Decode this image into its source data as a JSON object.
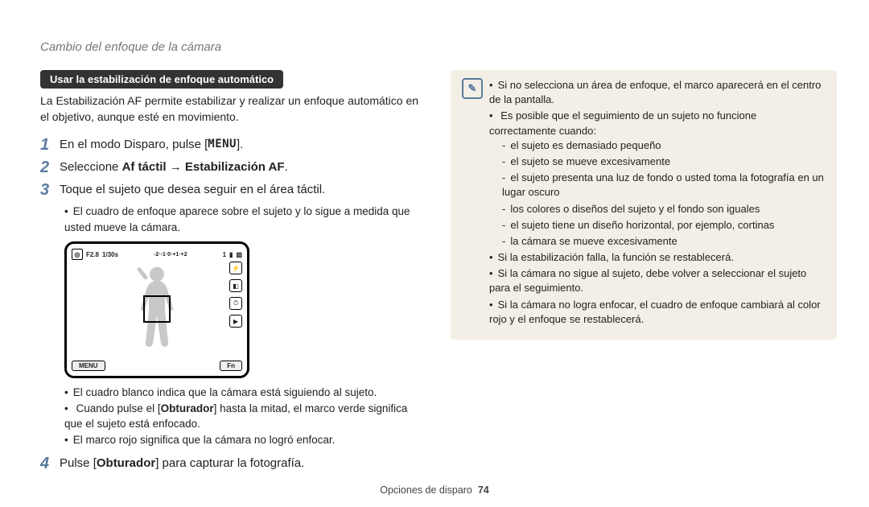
{
  "pageTitle": "Cambio del enfoque de la cámara",
  "section": {
    "pill": "Usar la estabilización de enfoque automático",
    "intro": "La Estabilización AF permite estabilizar y realizar un enfoque automático en el objetivo, aunque esté en movimiento."
  },
  "steps": {
    "s1_pre": "En el modo Disparo, pulse [",
    "s1_key": "MENU",
    "s1_post": "].",
    "s2_pre": "Seleccione ",
    "s2_b1": "Af táctil",
    "s2_arrow": " → ",
    "s2_b2": "Estabilización AF",
    "s2_post": ".",
    "s3": "Toque el sujeto que desea seguir en el área táctil.",
    "s3_sub": "El cuadro de enfoque aparece sobre el sujeto y lo sigue a medida que usted mueve la cámara.",
    "s4_pre": "Pulse [",
    "s4_b": "Obturador",
    "s4_post": "] para capturar la fotografía."
  },
  "cam": {
    "f": "F2.8",
    "shutter": "1/30s",
    "count": "1",
    "menuBtn": "MENU",
    "fnBtn": "Fn"
  },
  "postCamBullets": {
    "b1": "El cuadro blanco indica que la cámara está siguiendo al sujeto.",
    "b2_pre": "Cuando pulse el [",
    "b2_b": "Obturador",
    "b2_post": "] hasta la mitad, el marco verde significa que el sujeto está enfocado.",
    "b3": "El marco rojo significa que la cámara no logró enfocar."
  },
  "note": {
    "n1": "Si no selecciona un área de enfoque, el marco aparecerá en el centro de la pantalla.",
    "n2": "Es posible que el seguimiento de un sujeto no funcione correctamente cuando:",
    "n2a": "el sujeto es demasiado pequeño",
    "n2b": "el sujeto se mueve excesivamente",
    "n2c": "el sujeto presenta una luz de fondo o usted toma la fotografía en un lugar oscuro",
    "n2d": "los colores o diseños del sujeto y el fondo son iguales",
    "n2e": "el sujeto tiene un diseño horizontal, por ejemplo, cortinas",
    "n2f": "la cámara se mueve excesivamente",
    "n3": "Si la estabilización falla, la función se restablecerá.",
    "n4": "Si la cámara no sigue al sujeto, debe volver a seleccionar el sujeto para el seguimiento.",
    "n5": "Si la cámara no logra enfocar, el cuadro de enfoque cambiará al color rojo y el enfoque se restablecerá."
  },
  "footer": {
    "section": "Opciones de disparo",
    "page": "74"
  }
}
